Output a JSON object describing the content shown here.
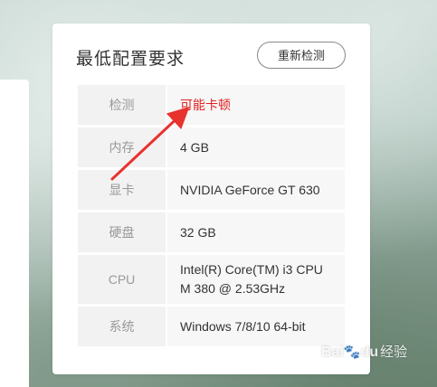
{
  "card": {
    "title": "最低配置要求",
    "recheck_label": "重新检测"
  },
  "specs": [
    {
      "label": "检测",
      "value": "可能卡顿"
    },
    {
      "label": "内存",
      "value": "4 GB"
    },
    {
      "label": "显卡",
      "value": "NVIDIA GeForce GT 630"
    },
    {
      "label": "硬盘",
      "value": "32 GB"
    },
    {
      "label": "CPU",
      "value": "Intel(R) Core(TM) i3 CPU",
      "value_line2": "M 380 @ 2.53GHz"
    },
    {
      "label": "系统",
      "value": "Windows 7/8/10 64-bit"
    }
  ],
  "colors": {
    "warning_text": "#e02020",
    "annotation_arrow": "#e8322e"
  },
  "watermark": {
    "brand": "Bai",
    "brand_tail": "du",
    "suffix": "经验",
    "icon": "paw-icon"
  }
}
